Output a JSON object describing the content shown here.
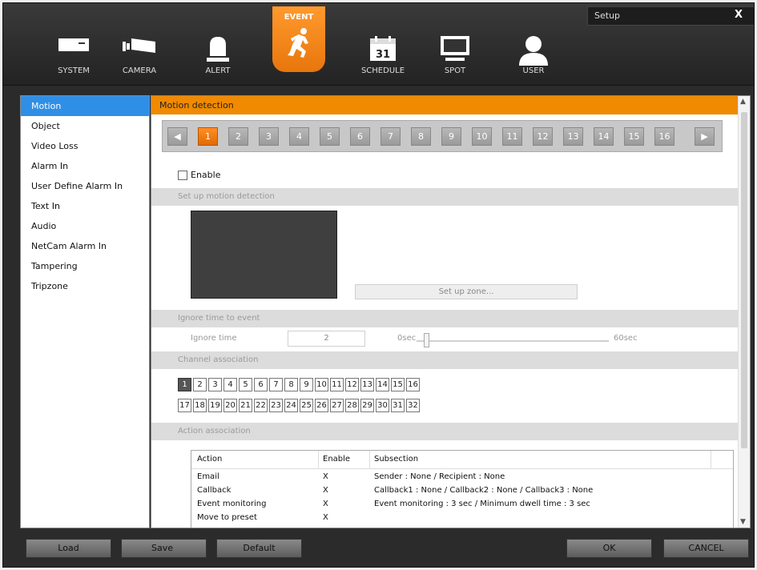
{
  "window": {
    "title": "Setup",
    "close_label": "X"
  },
  "tabs": [
    {
      "label": "SYSTEM",
      "icon": "system-icon"
    },
    {
      "label": "CAMERA",
      "icon": "camera-icon"
    },
    {
      "label": "ALERT",
      "icon": "alert-icon"
    },
    {
      "label": "EVENT",
      "icon": "running-man-icon",
      "active": true
    },
    {
      "label": "SCHEDULE",
      "icon": "calendar-icon",
      "calendar_day": "31"
    },
    {
      "label": "SPOT",
      "icon": "monitor-icon"
    },
    {
      "label": "USER",
      "icon": "user-icon"
    }
  ],
  "sidebar": {
    "items": [
      {
        "label": "Motion",
        "active": true
      },
      {
        "label": "Object"
      },
      {
        "label": "Video Loss"
      },
      {
        "label": "Alarm In"
      },
      {
        "label": "User Define Alarm In"
      },
      {
        "label": "Text In"
      },
      {
        "label": "Audio"
      },
      {
        "label": "NetCam Alarm In"
      },
      {
        "label": "Tampering"
      },
      {
        "label": "Tripzone"
      }
    ]
  },
  "main": {
    "header": "Motion detection",
    "channels": [
      "1",
      "2",
      "3",
      "4",
      "5",
      "6",
      "7",
      "8",
      "9",
      "10",
      "11",
      "12",
      "13",
      "14",
      "15",
      "16"
    ],
    "selected_channel": "1",
    "enable_label": "Enable",
    "enable_checked": false,
    "sections": {
      "setup": "Set up motion detection",
      "ignore": "Ignore time to event",
      "channel_assoc": "Channel association",
      "action_assoc": "Action association"
    },
    "setup_zone_label": "Set up zone...",
    "ignore_time": {
      "label": "Ignore time",
      "value": "2",
      "min_label": "0sec",
      "max_label": "60sec"
    },
    "assoc_channels_row1": [
      "1",
      "2",
      "3",
      "4",
      "5",
      "6",
      "7",
      "8",
      "9",
      "10",
      "11",
      "12",
      "13",
      "14",
      "15",
      "16"
    ],
    "assoc_channels_row2": [
      "17",
      "18",
      "19",
      "20",
      "21",
      "22",
      "23",
      "24",
      "25",
      "26",
      "27",
      "28",
      "29",
      "30",
      "31",
      "32"
    ],
    "assoc_selected": "1",
    "action_table": {
      "headers": [
        "Action",
        "Enable",
        "Subsection"
      ],
      "rows": [
        [
          "Email",
          "X",
          "Sender : None  /  Recipient : None"
        ],
        [
          "Callback",
          "X",
          "Callback1 : None / Callback2 : None / Callback3 : None"
        ],
        [
          "Event monitoring",
          "X",
          "Event monitoring : 3 sec / Minimum dwell time : 3 sec"
        ],
        [
          "Move to preset",
          "X",
          ""
        ]
      ]
    }
  },
  "footer": {
    "load": "Load",
    "save": "Save",
    "default": "Default",
    "ok": "OK",
    "cancel": "CANCEL"
  },
  "colors": {
    "accent": "#f08a00",
    "selection": "#2f8fe6"
  }
}
